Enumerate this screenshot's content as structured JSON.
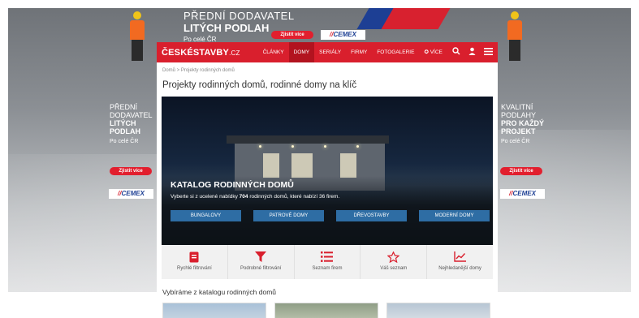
{
  "ad": {
    "top_line1": "PŘEDNÍ DODAVATEL",
    "top_line2": "LITÝCH PODLAH",
    "top_line3": "Po celé ČR",
    "left_lines": [
      "PŘEDNÍ",
      "DODAVATEL",
      "LITÝCH",
      "PODLAH"
    ],
    "left_small": "Po celé ČR",
    "right_lines": [
      "KVALITNÍ",
      "PODLAHY",
      "PRO KAŽDÝ",
      "PROJEKT"
    ],
    "right_small": "Po celé ČR",
    "cta": "Zjistit více",
    "brand": "CEMEX"
  },
  "nav": {
    "logo": "ČESKÉSTAVBY",
    "logo_suffix": ".CZ",
    "items": [
      {
        "label": "ČLÁNKY",
        "active": false
      },
      {
        "label": "DOMY",
        "active": true
      },
      {
        "label": "SERIÁLY",
        "active": false
      },
      {
        "label": "FIRMY",
        "active": false
      },
      {
        "label": "FOTOGALERIE",
        "active": false
      },
      {
        "label": "✪ VÍCE",
        "active": false
      }
    ],
    "icons": [
      "search-icon",
      "user-icon",
      "menu-icon"
    ],
    "accent_color": "#d91f2d"
  },
  "breadcrumb": "Domů > Projekty rodinných domů",
  "page_title": "Projekty rodinných domů, rodinné domy na klíč",
  "hero": {
    "title": "KATALOG RODINNÝCH DOMŮ",
    "sub_before": "Vyberte si z ucelené nabídky ",
    "sub_count": "704",
    "sub_after": " rodinných domů, které nabízí 36 firem.",
    "buttons": [
      "BUNGALOVY",
      "PATROVÉ DOMY",
      "DŘEVOSTAVBY",
      "MODERNÍ DOMY"
    ]
  },
  "quick_links": [
    {
      "icon": "book-icon",
      "label": "Rychlé filtrování"
    },
    {
      "icon": "filter-icon",
      "label": "Podrobné filtrování"
    },
    {
      "icon": "list-icon",
      "label": "Seznam firem"
    },
    {
      "icon": "star-icon",
      "label": "Váš seznam"
    },
    {
      "icon": "trend-chart-icon",
      "label": "Nejhledanější domy"
    }
  ],
  "section_title": "Vybíráme z katalogu rodinných domů"
}
